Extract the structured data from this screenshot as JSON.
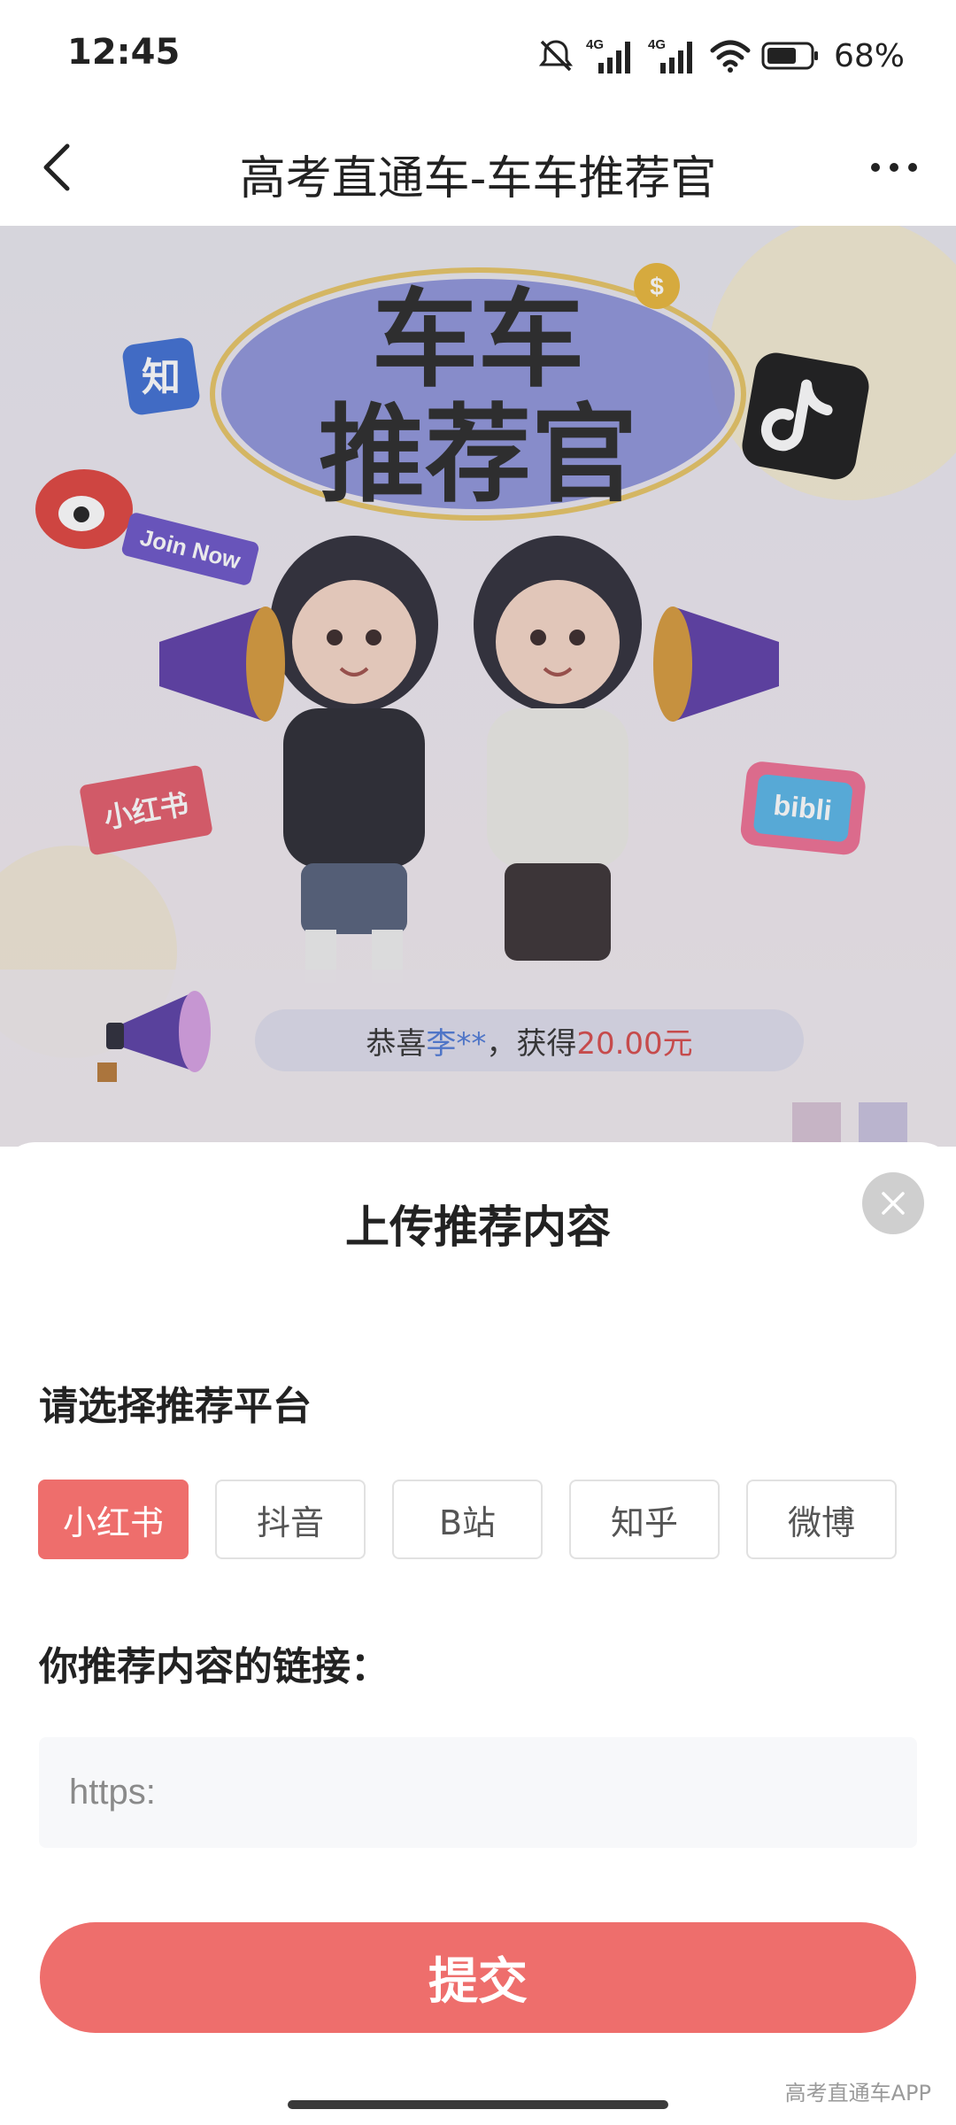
{
  "status_bar": {
    "time": "12:45",
    "battery_percent": "68%",
    "network_1": "4G",
    "network_2": "4G",
    "icons": [
      "mute-icon",
      "signal-icon",
      "signal-icon",
      "wifi-icon",
      "battery-icon"
    ]
  },
  "nav": {
    "title": "高考直通车-车车推荐官",
    "back_icon": "chevron-left-icon",
    "more_icon": "more-horizontal-icon"
  },
  "banner": {
    "headline_line1": "车车",
    "headline_line2": "推荐官",
    "badge_zhihu": "知",
    "badge_join": "Join Now",
    "badge_xiaohongshu": "小红书",
    "badge_bilibili": "bibli",
    "ticker_prefix": "恭喜",
    "ticker_name": "李**",
    "ticker_mid": "，获得",
    "ticker_amount": "20.00元"
  },
  "sheet": {
    "title": "上传推荐内容",
    "platform_label": "请选择推荐平台",
    "platforms": [
      {
        "label": "小红书",
        "selected": true
      },
      {
        "label": "抖音",
        "selected": false
      },
      {
        "label": "B站",
        "selected": false
      },
      {
        "label": "知乎",
        "selected": false
      },
      {
        "label": "微博",
        "selected": false
      }
    ],
    "link_label": "你推荐内容的链接：",
    "link_placeholder": "https:",
    "link_value": "",
    "submit_label": "提交"
  },
  "watermark": "高考直通车APP",
  "colors": {
    "accent": "#ee6e6c",
    "ticker_name": "#4f7ad6",
    "ticker_amount": "#d64a4a"
  }
}
